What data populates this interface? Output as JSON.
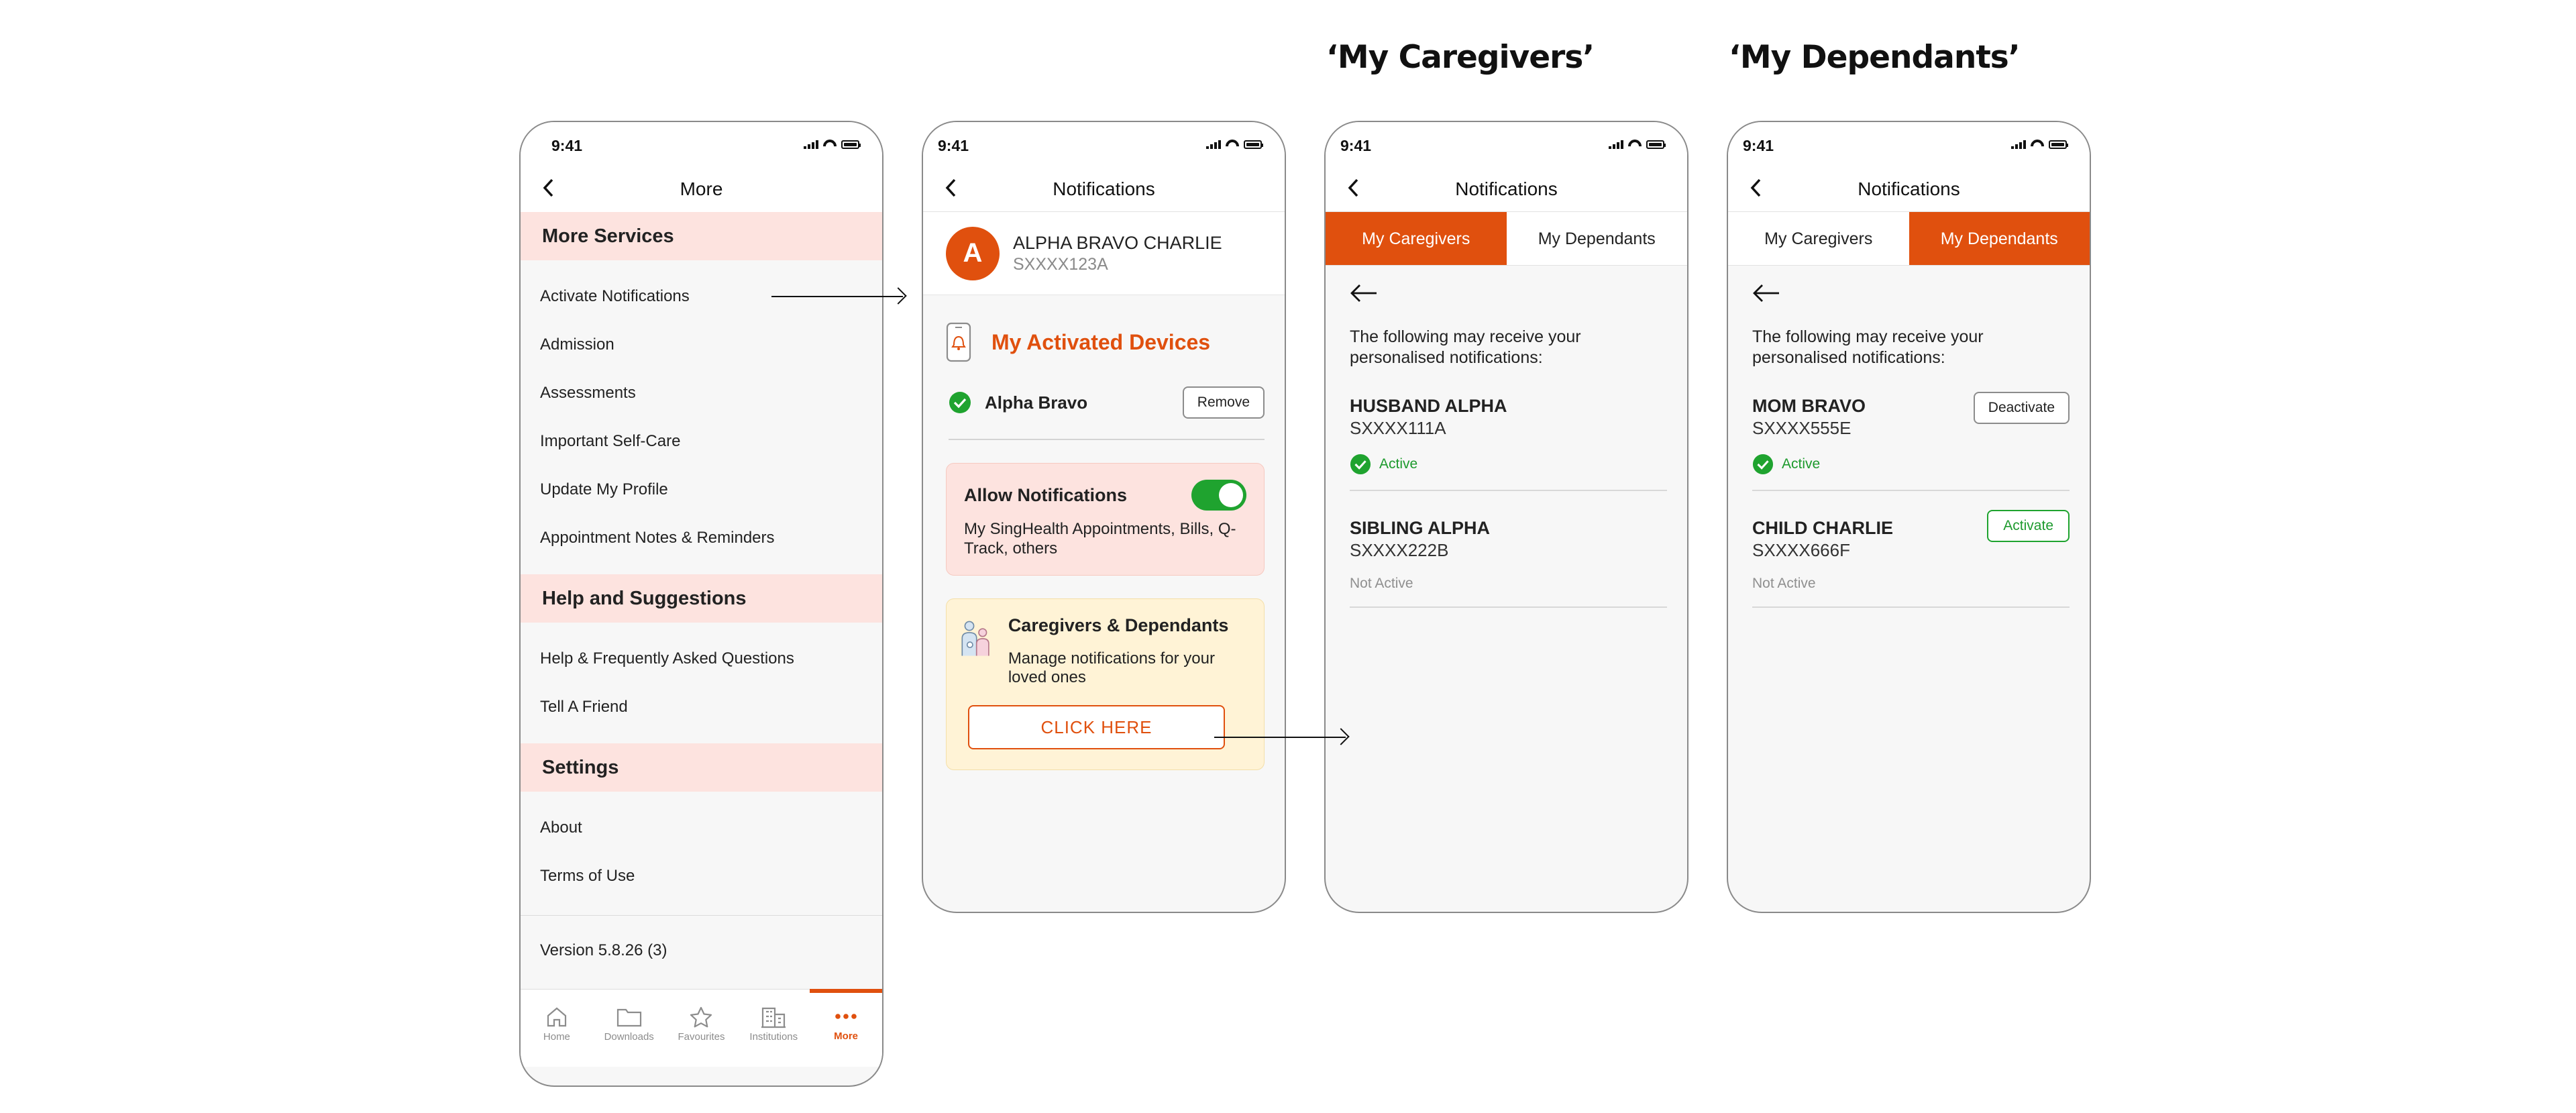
{
  "frame_titles": {
    "caregivers": "‘My Caregivers’",
    "dependants": "‘My Dependants’"
  },
  "status_time": "9:41",
  "screen1": {
    "nav_title": "More",
    "sections": [
      {
        "title": "More Services",
        "items": [
          "Activate Notifications",
          "Admission",
          "Assessments",
          "Important Self-Care",
          "Update My Profile",
          "Appointment Notes & Reminders"
        ]
      },
      {
        "title": "Help and Suggestions",
        "items": [
          "Help & Frequently Asked Questions",
          "Tell A Friend"
        ]
      },
      {
        "title": "Settings",
        "items": [
          "About",
          "Terms of Use"
        ]
      }
    ],
    "version": "Version 5.8.26 (3)",
    "tabs": [
      {
        "label": "Home",
        "icon": "home-icon"
      },
      {
        "label": "Downloads",
        "icon": "folder-icon"
      },
      {
        "label": "Favourites",
        "icon": "star-icon"
      },
      {
        "label": "Institutions",
        "icon": "building-icon"
      },
      {
        "label": "More",
        "icon": "more-dots-icon",
        "active": true
      }
    ]
  },
  "screen2": {
    "nav_title": "Notifications",
    "avatar_letter": "A",
    "user_name": "ALPHA BRAVO CHARLIE",
    "user_id": "SXXXX123A",
    "devices_title": "My Activated Devices",
    "device_name": "Alpha Bravo",
    "remove_label": "Remove",
    "allow_title": "Allow Notifications",
    "allow_desc": "My SingHealth Appointments, Bills, Q-Track, others",
    "allow_enabled": true,
    "cg_title": "Caregivers & Dependants",
    "cg_desc": "Manage notifications for your loved ones",
    "cta_label": "CLICK HERE"
  },
  "screen3": {
    "nav_title": "Notifications",
    "tab_caregivers": "My Caregivers",
    "tab_dependants": "My Dependants",
    "active_tab": "caregivers",
    "intro": "The following may receive your personalised notifications:",
    "people": [
      {
        "name": "HUSBAND ALPHA",
        "id": "SXXXX111A",
        "status": "Active"
      },
      {
        "name": "SIBLING ALPHA",
        "id": "SXXXX222B",
        "status": "Not Active"
      }
    ]
  },
  "screen4": {
    "nav_title": "Notifications",
    "tab_caregivers": "My Caregivers",
    "tab_dependants": "My Dependants",
    "active_tab": "dependants",
    "intro": "The following may receive your personalised notifications:",
    "people": [
      {
        "name": "MOM BRAVO",
        "id": "SXXXX555E",
        "status": "Active",
        "action": "Deactivate"
      },
      {
        "name": "CHILD CHARLIE",
        "id": "SXXXX666F",
        "status": "Not Active",
        "action": "Activate"
      }
    ]
  },
  "colors": {
    "accent": "#e0500e",
    "section_bg": "#fde3df",
    "success": "#1fa32f",
    "card_yellow": "#fff3d6"
  }
}
